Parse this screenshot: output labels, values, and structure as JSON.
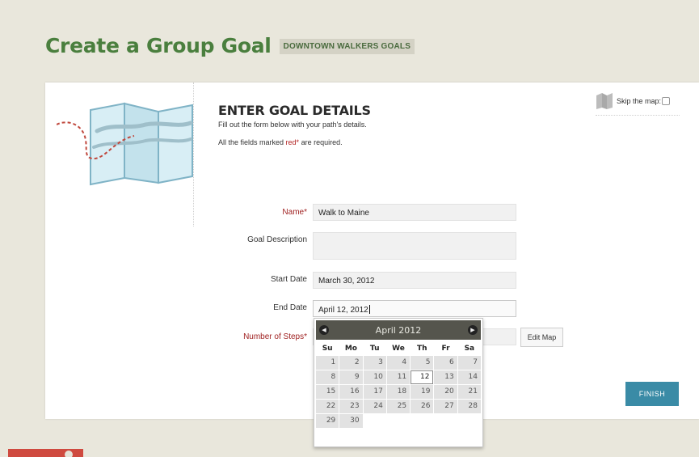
{
  "header": {
    "title": "Create a Group Goal",
    "group_badge": "DOWNTOWN WALKERS GOALS"
  },
  "form_intro": {
    "title": "ENTER GOAL DETAILS",
    "instructions": "Fill out the form below with your path's details.",
    "required_prefix": "All the fields marked ",
    "required_word": "red*",
    "required_suffix": " are required."
  },
  "skip_map": {
    "label": "Skip the map:",
    "checked": false
  },
  "fields": {
    "name": {
      "label": "Name*",
      "value": "Walk to Maine"
    },
    "description": {
      "label": "Goal Description",
      "value": ""
    },
    "start_date": {
      "label": "Start Date",
      "value": "March 30, 2012"
    },
    "end_date": {
      "label": "End Date",
      "value": "April 12, 2012"
    },
    "steps": {
      "label": "Number of Steps*",
      "value": ""
    }
  },
  "buttons": {
    "edit_map": "Edit Map",
    "finish": "FINISH"
  },
  "datepicker": {
    "month_label": "April 2012",
    "prev_icon": "◀",
    "next_icon": "▶",
    "weekdays": [
      "Su",
      "Mo",
      "Tu",
      "We",
      "Th",
      "Fr",
      "Sa"
    ],
    "selected_day": 12,
    "weeks": [
      [
        "1",
        "2",
        "3",
        "4",
        "5",
        "6",
        "7"
      ],
      [
        "8",
        "9",
        "10",
        "11",
        "12",
        "13",
        "14"
      ],
      [
        "15",
        "16",
        "17",
        "18",
        "19",
        "20",
        "21"
      ],
      [
        "22",
        "23",
        "24",
        "25",
        "26",
        "27",
        "28"
      ],
      [
        "29",
        "30",
        "",
        "",
        "",
        "",
        ""
      ]
    ]
  },
  "colors": {
    "title_green": "#4a7f3e",
    "finish_blue": "#3a8ba6",
    "required_red": "#a02222",
    "datepicker_header": "#55554d",
    "page_background": "#e9e7dc"
  }
}
